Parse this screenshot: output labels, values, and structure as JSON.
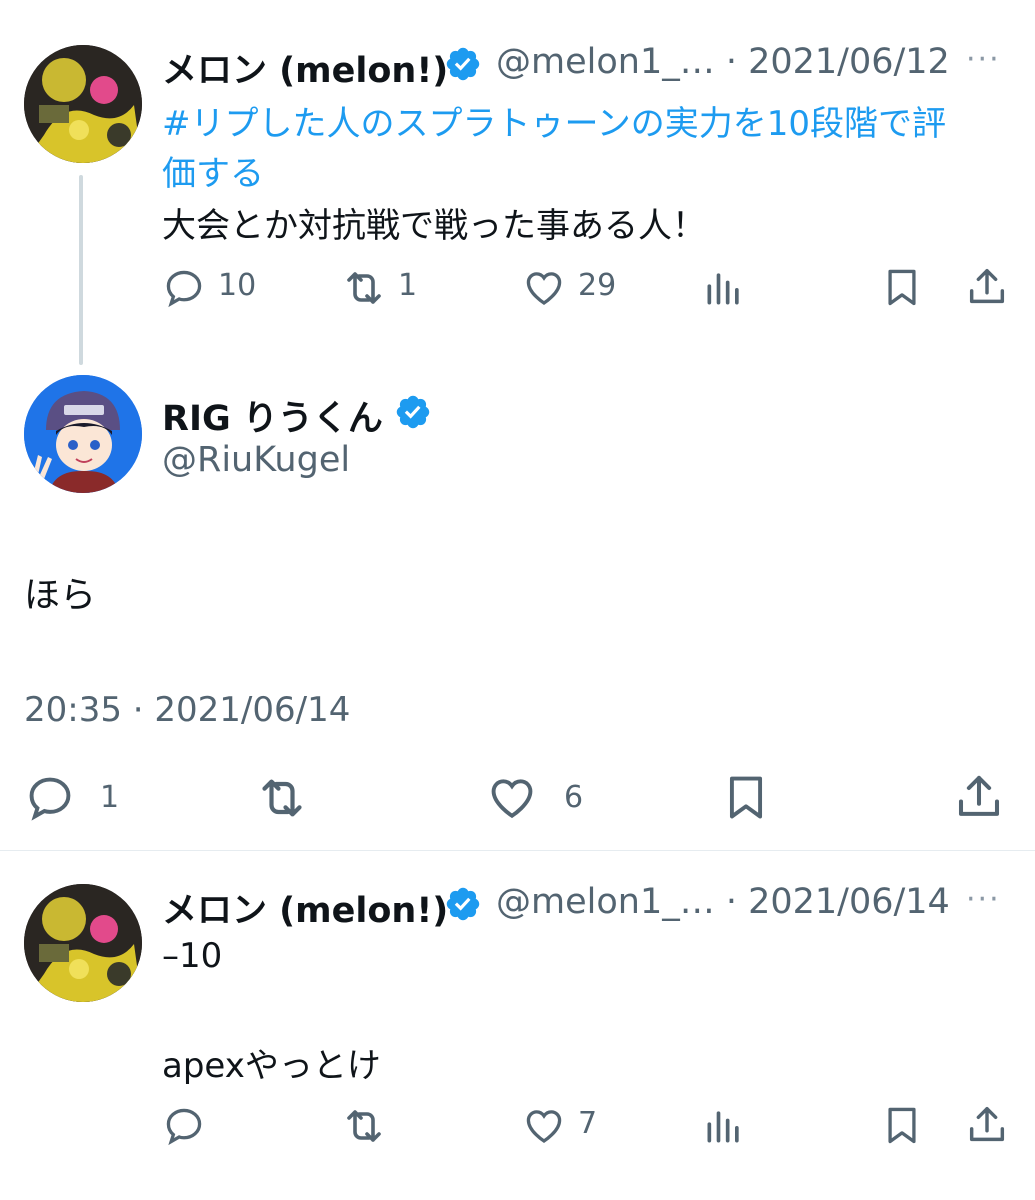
{
  "tweet1": {
    "name": "メロン (melon!)",
    "handle_date": "@melon1_… · 2021/06/12",
    "hashtag_line1": "#リプした人のスプラトゥーンの実力を10段階で評",
    "hashtag_line2": "価する",
    "body": "大会とか対抗戦で戦った事ある人！",
    "replies": "10",
    "retweets": "1",
    "likes": "29"
  },
  "tweet2": {
    "name": "RIG りうくん",
    "handle": "@RiuKugel",
    "body": "ほら",
    "timestamp": "20:35 · 2021/06/14",
    "replies": "1",
    "likes": "6"
  },
  "tweet3": {
    "name": "メロン (melon!)",
    "handle_date": "@melon1_… · 2021/06/14",
    "line1": "–10",
    "line2": "apexやっとけ",
    "likes": "7"
  },
  "colors": {
    "link": "#1d9bf0",
    "verified": "#1d9bf0",
    "muted": "#536471",
    "text": "#0f1419"
  },
  "icons": [
    "reply-icon",
    "retweet-icon",
    "like-icon",
    "views-icon",
    "bookmark-icon",
    "share-icon",
    "verified-icon",
    "more-icon"
  ]
}
